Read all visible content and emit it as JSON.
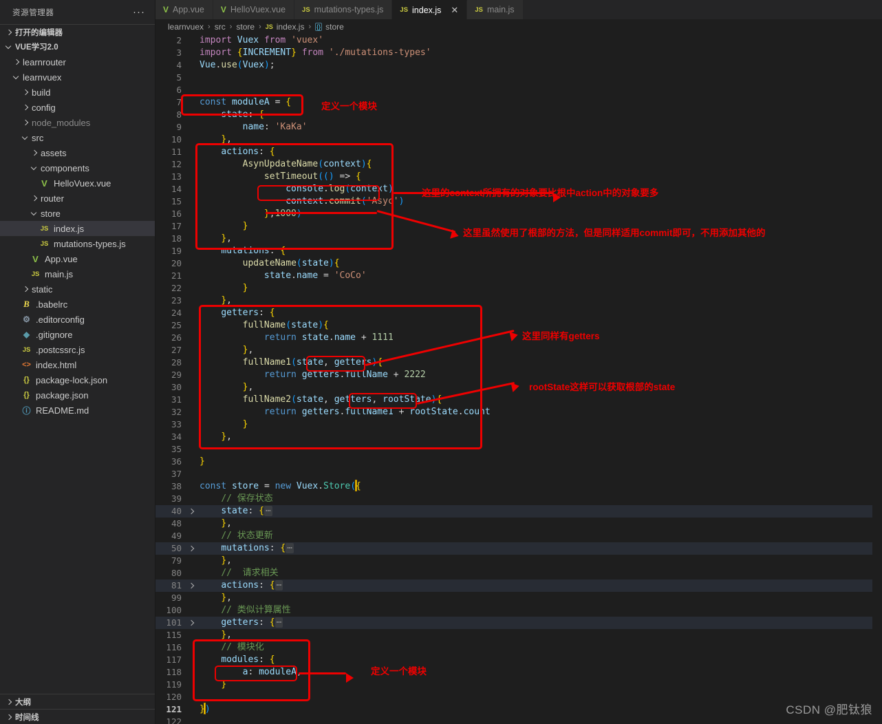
{
  "sidebar": {
    "title": "资源管理器",
    "more_label": "···",
    "open_editors_label": "打开的编辑器",
    "root_label": "VUE学习2.0",
    "tree": [
      {
        "label": "learnrouter",
        "indent": 1,
        "kind": "folder",
        "open": false,
        "dim": false
      },
      {
        "label": "learnvuex",
        "indent": 1,
        "kind": "folder",
        "open": true,
        "dim": false
      },
      {
        "label": "build",
        "indent": 2,
        "kind": "folder",
        "open": false,
        "dim": false
      },
      {
        "label": "config",
        "indent": 2,
        "kind": "folder",
        "open": false,
        "dim": false
      },
      {
        "label": "node_modules",
        "indent": 2,
        "kind": "folder",
        "open": false,
        "dim": true
      },
      {
        "label": "src",
        "indent": 2,
        "kind": "folder",
        "open": true,
        "dim": false
      },
      {
        "label": "assets",
        "indent": 3,
        "kind": "folder",
        "open": false,
        "dim": false
      },
      {
        "label": "components",
        "indent": 3,
        "kind": "folder",
        "open": true,
        "dim": false
      },
      {
        "label": "HelloVuex.vue",
        "indent": 4,
        "kind": "vue",
        "open": false,
        "dim": false
      },
      {
        "label": "router",
        "indent": 3,
        "kind": "folder",
        "open": false,
        "dim": false
      },
      {
        "label": "store",
        "indent": 3,
        "kind": "folder",
        "open": true,
        "dim": false
      },
      {
        "label": "index.js",
        "indent": 4,
        "kind": "js",
        "open": false,
        "dim": false,
        "selected": true
      },
      {
        "label": "mutations-types.js",
        "indent": 4,
        "kind": "js",
        "open": false,
        "dim": false
      },
      {
        "label": "App.vue",
        "indent": 3,
        "kind": "vue",
        "open": false,
        "dim": false
      },
      {
        "label": "main.js",
        "indent": 3,
        "kind": "js",
        "open": false,
        "dim": false
      },
      {
        "label": "static",
        "indent": 2,
        "kind": "folder",
        "open": false,
        "dim": false
      },
      {
        "label": ".babelrc",
        "indent": 2,
        "kind": "babel",
        "open": false,
        "dim": false
      },
      {
        "label": ".editorconfig",
        "indent": 2,
        "kind": "gear",
        "open": false,
        "dim": false
      },
      {
        "label": ".gitignore",
        "indent": 2,
        "kind": "git",
        "open": false,
        "dim": false
      },
      {
        "label": ".postcssrc.js",
        "indent": 2,
        "kind": "js",
        "open": false,
        "dim": false
      },
      {
        "label": "index.html",
        "indent": 2,
        "kind": "html",
        "open": false,
        "dim": false
      },
      {
        "label": "package-lock.json",
        "indent": 2,
        "kind": "json",
        "open": false,
        "dim": false
      },
      {
        "label": "package.json",
        "indent": 2,
        "kind": "json",
        "open": false,
        "dim": false
      },
      {
        "label": "README.md",
        "indent": 2,
        "kind": "md",
        "open": false,
        "dim": false
      }
    ],
    "bottom_sections": [
      {
        "label": "大纲"
      },
      {
        "label": "时间线"
      }
    ]
  },
  "tabs": [
    {
      "label": "App.vue",
      "icon": "vue-icon",
      "active": false,
      "closable": false
    },
    {
      "label": "HelloVuex.vue",
      "icon": "vue-icon",
      "active": false,
      "closable": false
    },
    {
      "label": "mutations-types.js",
      "icon": "js-icon",
      "active": false,
      "closable": false
    },
    {
      "label": "index.js",
      "icon": "js-icon",
      "active": true,
      "closable": true,
      "close_label": "✕"
    },
    {
      "label": "main.js",
      "icon": "js-icon",
      "active": false,
      "closable": false
    }
  ],
  "breadcrumb": {
    "items": [
      "learnvuex",
      "src",
      "store",
      "index.js",
      "store"
    ],
    "separator": "›",
    "js_badge": "JS",
    "ns_badge": "{}"
  },
  "editor": {
    "first_visible_line": 2,
    "cursor_line": 121,
    "lines": [
      {
        "n": 2,
        "fold": false,
        "hl": false
      },
      {
        "n": 3,
        "fold": false,
        "hl": false
      },
      {
        "n": 4,
        "fold": false,
        "hl": false
      },
      {
        "n": 5,
        "fold": false,
        "hl": false
      },
      {
        "n": 6,
        "fold": false,
        "hl": false
      },
      {
        "n": 7,
        "fold": false,
        "hl": false
      },
      {
        "n": 8,
        "fold": false,
        "hl": false
      },
      {
        "n": 9,
        "fold": false,
        "hl": false
      },
      {
        "n": 10,
        "fold": false,
        "hl": false
      },
      {
        "n": 11,
        "fold": false,
        "hl": false
      },
      {
        "n": 12,
        "fold": false,
        "hl": false
      },
      {
        "n": 13,
        "fold": false,
        "hl": false
      },
      {
        "n": 14,
        "fold": false,
        "hl": false
      },
      {
        "n": 15,
        "fold": false,
        "hl": false
      },
      {
        "n": 16,
        "fold": false,
        "hl": false
      },
      {
        "n": 17,
        "fold": false,
        "hl": false
      },
      {
        "n": 18,
        "fold": false,
        "hl": false
      },
      {
        "n": 19,
        "fold": false,
        "hl": false
      },
      {
        "n": 20,
        "fold": false,
        "hl": false
      },
      {
        "n": 21,
        "fold": false,
        "hl": false
      },
      {
        "n": 22,
        "fold": false,
        "hl": false
      },
      {
        "n": 23,
        "fold": false,
        "hl": false
      },
      {
        "n": 24,
        "fold": false,
        "hl": false
      },
      {
        "n": 25,
        "fold": false,
        "hl": false
      },
      {
        "n": 26,
        "fold": false,
        "hl": false
      },
      {
        "n": 27,
        "fold": false,
        "hl": false
      },
      {
        "n": 28,
        "fold": false,
        "hl": false
      },
      {
        "n": 29,
        "fold": false,
        "hl": false
      },
      {
        "n": 30,
        "fold": false,
        "hl": false
      },
      {
        "n": 31,
        "fold": false,
        "hl": false
      },
      {
        "n": 32,
        "fold": false,
        "hl": false
      },
      {
        "n": 33,
        "fold": false,
        "hl": false
      },
      {
        "n": 34,
        "fold": false,
        "hl": false
      },
      {
        "n": 35,
        "fold": false,
        "hl": false
      },
      {
        "n": 36,
        "fold": false,
        "hl": false
      },
      {
        "n": 37,
        "fold": false,
        "hl": false
      },
      {
        "n": 38,
        "fold": false,
        "hl": false
      },
      {
        "n": 39,
        "fold": false,
        "hl": false
      },
      {
        "n": 40,
        "fold": true,
        "hl": true
      },
      {
        "n": 48,
        "fold": false,
        "hl": false
      },
      {
        "n": 49,
        "fold": false,
        "hl": false
      },
      {
        "n": 50,
        "fold": true,
        "hl": true
      },
      {
        "n": 79,
        "fold": false,
        "hl": false
      },
      {
        "n": 80,
        "fold": false,
        "hl": false
      },
      {
        "n": 81,
        "fold": true,
        "hl": true
      },
      {
        "n": 99,
        "fold": false,
        "hl": false
      },
      {
        "n": 100,
        "fold": false,
        "hl": false
      },
      {
        "n": 101,
        "fold": true,
        "hl": true
      },
      {
        "n": 115,
        "fold": false,
        "hl": false
      },
      {
        "n": 116,
        "fold": false,
        "hl": false
      },
      {
        "n": 117,
        "fold": false,
        "hl": false
      },
      {
        "n": 118,
        "fold": false,
        "hl": false
      },
      {
        "n": 119,
        "fold": false,
        "hl": false
      },
      {
        "n": 120,
        "fold": false,
        "hl": false
      },
      {
        "n": 121,
        "fold": false,
        "hl": false
      },
      {
        "n": 122,
        "fold": false,
        "hl": false
      }
    ],
    "source_text": [
      "import Vuex from 'vuex'",
      "import {INCREMENT} from './mutations-types'",
      "Vue.use(Vuex);",
      "",
      "",
      "const moduleA = {",
      "    state: {",
      "        name: 'KaKa'",
      "    },",
      "    actions: {",
      "        AsynUpdateName(context){",
      "            setTimeout(() => {",
      "                console.log(context)",
      "                context.commit('Asyc')",
      "            },1000)",
      "        }",
      "    },",
      "    mutations: {",
      "        updateName(state){",
      "            state.name = 'CoCo'",
      "        }",
      "    },",
      "    getters: {",
      "        fullName(state){",
      "            return state.name + 1111",
      "        },",
      "        fullName1(state, getters){",
      "            return getters.fullName + 2222",
      "        },",
      "        fullName2(state, getters, rootState){",
      "            return getters.fullName1 + rootState.count",
      "        }",
      "    },",
      "",
      "}",
      "",
      "const store = new Vuex.Store({",
      "    // 保存状态",
      "    state: {…",
      "    },",
      "    // 状态更新",
      "    mutations: {…",
      "    },",
      "    //  请求相关",
      "    actions: {…",
      "    },",
      "    // 类似计算属性",
      "    getters: {…",
      "    },",
      "    // 模块化",
      "    modules: {",
      "        a: moduleA,",
      "    }",
      "",
      "})"
    ]
  },
  "annotations": {
    "color": "#ee0000",
    "notes": [
      {
        "id": "note-define-module-top",
        "text": "定义一个模块"
      },
      {
        "id": "note-context-object",
        "text": "这里的context所拥有的对象要比根中action中的对象要多"
      },
      {
        "id": "note-commit-root",
        "text": "这里虽然使用了根部的方法，但是同样适用commit即可，不用添加其他的"
      },
      {
        "id": "note-getters-also",
        "text": "这里同样有getters"
      },
      {
        "id": "note-rootstate",
        "text": "rootState这样可以获取根部的state"
      },
      {
        "id": "note-define-module-bottom",
        "text": "定义一个模块"
      }
    ],
    "boxes": [
      {
        "id": "box-const-modulea"
      },
      {
        "id": "box-actions-block"
      },
      {
        "id": "box-console-log"
      },
      {
        "id": "box-getters-block"
      },
      {
        "id": "box-getters-param"
      },
      {
        "id": "box-rootstate-param"
      },
      {
        "id": "box-modules-block"
      },
      {
        "id": "box-a-modulea"
      }
    ]
  },
  "watermark": "CSDN @肥钛狼"
}
